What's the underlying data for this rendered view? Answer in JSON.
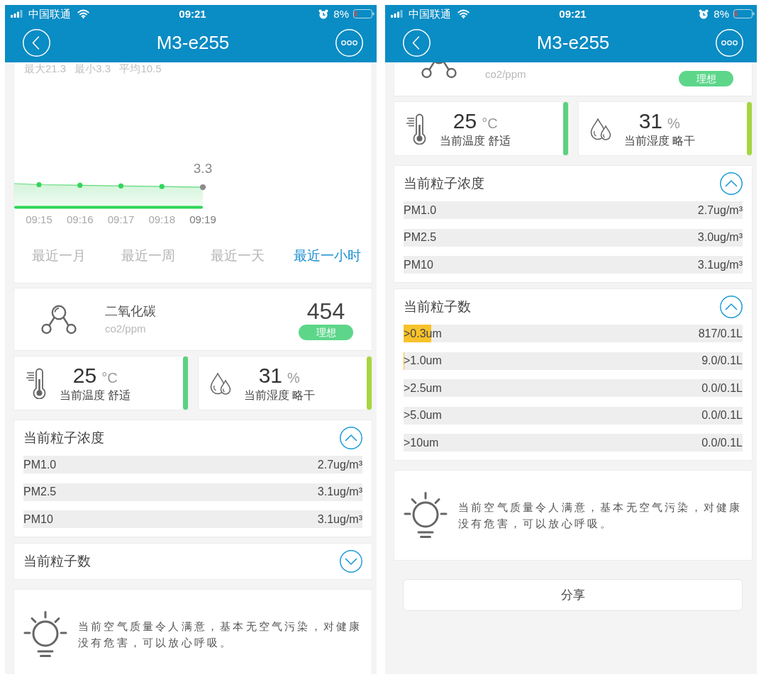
{
  "phones": [
    {
      "status_bar": {
        "carrier": "中国联通",
        "time": "09:21",
        "battery": "8%"
      },
      "title": "M3-e255",
      "sections": [
        {
          "kind": "chart",
          "stats": "最大21.3 最小3.3 平均10.5",
          "value_label": "3.3",
          "x_labels": [
            {
              "label": "09:15",
              "highlighted": false
            },
            {
              "label": "09:16",
              "highlighted": false
            },
            {
              "label": "09:17",
              "highlighted": false
            },
            {
              "label": "09:18",
              "highlighted": false
            },
            {
              "label": "09:19",
              "highlighted": true
            }
          ],
          "periods": [
            {
              "label": "最近一月",
              "selected": false
            },
            {
              "label": "最近一周",
              "selected": false
            },
            {
              "label": "最近一天",
              "selected": false
            },
            {
              "label": "最近一小时",
              "selected": true
            }
          ]
        },
        {
          "kind": "co2",
          "name": "二氧化碳",
          "unit": "co2/ppm",
          "value": "454",
          "badge": "理想"
        },
        {
          "kind": "climate",
          "cards": [
            {
              "kind": "temperature",
              "value": "25",
              "unit": "°C",
              "label": "当前温度 舒适",
              "color": "#5ad27f"
            },
            {
              "kind": "humidity",
              "value": "31",
              "unit": "%",
              "label": "当前湿度 略干",
              "color": "#a6d641"
            }
          ]
        },
        {
          "kind": "particles",
          "title": "当前粒子浓度",
          "expanded": true,
          "rows": [
            {
              "label": "PM1.0",
              "value": "2.7ug/m³"
            },
            {
              "label": "PM2.5",
              "value": "3.1ug/m³"
            },
            {
              "label": "PM10",
              "value": "3.1ug/m³"
            }
          ]
        },
        {
          "kind": "particles",
          "title": "当前粒子数",
          "expanded": false
        },
        {
          "kind": "advice",
          "text": "当前空气质量令人满意，基本无空气污染，对健康没有危害，可以放心呼吸。"
        }
      ]
    },
    {
      "status_bar": {
        "carrier": "中国联通",
        "time": "09:21",
        "battery": "8%"
      },
      "title": "M3-e255",
      "sections": [
        {
          "kind": "co2_tail",
          "unit": "co2/ppm",
          "badge": "理想"
        },
        {
          "kind": "climate",
          "cards": [
            {
              "kind": "temperature",
              "value": "25",
              "unit": "°C",
              "label": "当前温度 舒适",
              "color": "#5ad27f"
            },
            {
              "kind": "humidity",
              "value": "31",
              "unit": "%",
              "label": "当前湿度 略干",
              "color": "#a6d641"
            }
          ]
        },
        {
          "kind": "particles",
          "title": "当前粒子浓度",
          "expanded": true,
          "rows": [
            {
              "label": "PM1.0",
              "value": "2.7ug/m³"
            },
            {
              "label": "PM2.5",
              "value": "3.0ug/m³"
            },
            {
              "label": "PM10",
              "value": "3.1ug/m³"
            }
          ]
        },
        {
          "kind": "particles",
          "title": "当前粒子数",
          "expanded": true,
          "rows": [
            {
              "label": ">0.3um",
              "value": "817/0.1L",
              "level": 0.082
            },
            {
              "label": ">1.0um",
              "value": "9.0/0.1L",
              "level": 0.003
            },
            {
              "label": ">2.5um",
              "value": "0.0/0.1L"
            },
            {
              "label": ">5.0um",
              "value": "0.0/0.1L"
            },
            {
              "label": ">10um",
              "value": "0.0/0.1L"
            }
          ]
        },
        {
          "kind": "advice",
          "text": "当前空气质量令人满意，基本无空气污染，对健康没有危害，可以放心呼吸。"
        }
      ],
      "share_button": "分享"
    }
  ]
}
